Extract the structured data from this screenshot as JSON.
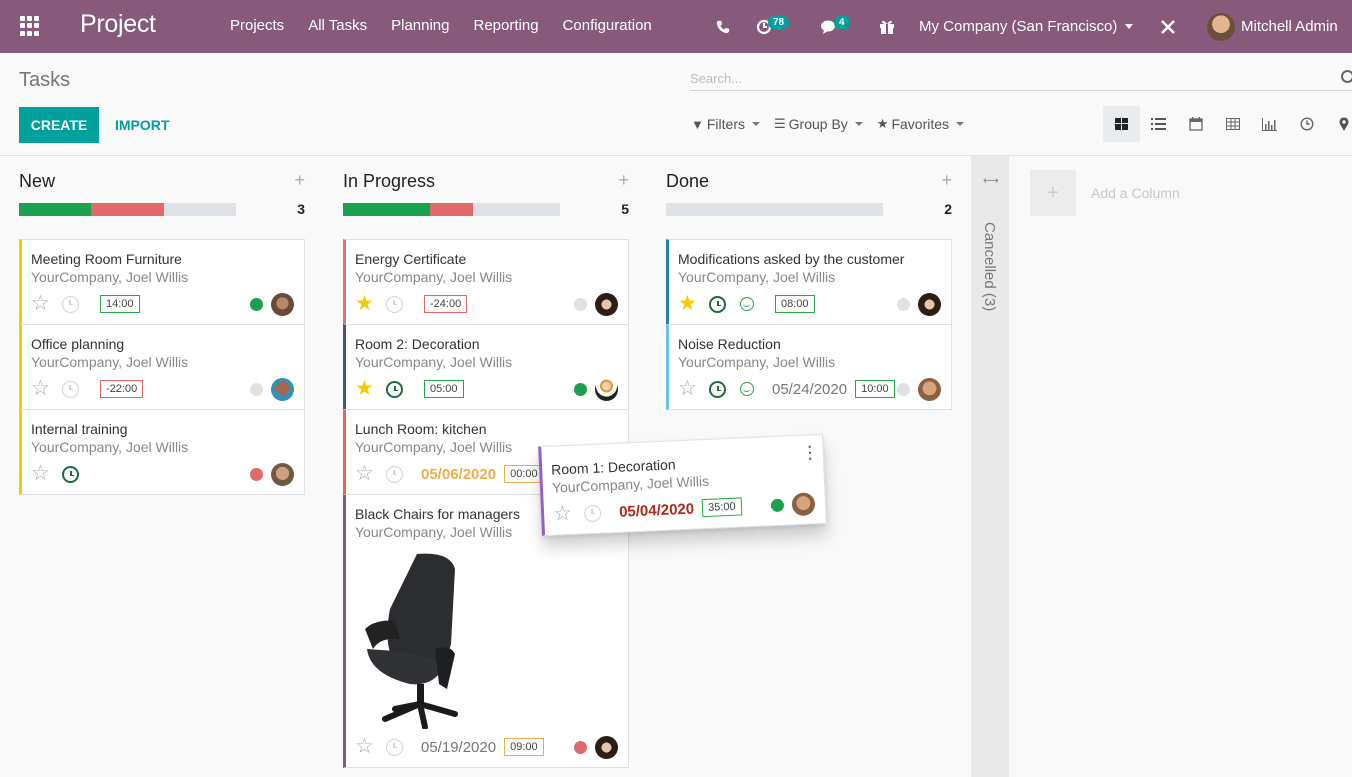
{
  "navbar": {
    "app_name": "Project",
    "menu": [
      "Projects",
      "All Tasks",
      "Planning",
      "Reporting",
      "Configuration"
    ],
    "activity_count": "78",
    "messages_count": "4",
    "company": "My Company (San Francisco)",
    "user": "Mitchell Admin",
    "brand_color": "#875a7b"
  },
  "control_panel": {
    "breadcrumb": "Tasks",
    "create_label": "CREATE",
    "import_label": "IMPORT",
    "search_placeholder": "Search...",
    "filters_label": "Filters",
    "group_by_label": "Group By",
    "favorites_label": "Favorites",
    "views": [
      "kanban",
      "list",
      "calendar",
      "pivot",
      "graph",
      "activity",
      "map"
    ],
    "active_view": "kanban"
  },
  "columns": [
    {
      "title": "New",
      "count": "3",
      "progress": {
        "green": 0.333,
        "red": 0.333,
        "grey": 0.334
      },
      "cards": [
        {
          "title": "Meeting Room Furniture",
          "subtitle": "YourCompany, Joel Willis",
          "starred": false,
          "activity": "grey",
          "date": "",
          "hours": "14:00",
          "hours_color": "green",
          "state": "green",
          "avatar": "av-m1",
          "border": "#f3cc00"
        },
        {
          "title": "Office planning",
          "subtitle": "YourCompany, Joel Willis",
          "starred": false,
          "activity": "grey",
          "date": "",
          "hours": "-22:00",
          "hours_color": "red",
          "state": "grey",
          "avatar": "av-m2",
          "border": "#f3cc00"
        },
        {
          "title": "Internal training",
          "subtitle": "YourCompany, Joel Willis",
          "starred": false,
          "activity": "green",
          "date": "",
          "hours": "",
          "hours_color": "",
          "state": "red",
          "avatar": "av-m3",
          "border": "#f3cc00"
        }
      ]
    },
    {
      "title": "In Progress",
      "count": "5",
      "progress": {
        "green": 0.4,
        "red": 0.2,
        "grey": 0.4
      },
      "cards": [
        {
          "title": "Energy Certificate",
          "subtitle": "YourCompany, Joel Willis",
          "starred": true,
          "activity": "grey",
          "date": "",
          "hours": "-24:00",
          "hours_color": "red",
          "state": "grey",
          "avatar": "av-f1",
          "border": "#f06e6e"
        },
        {
          "title": "Room 2: Decoration",
          "subtitle": "YourCompany, Joel Willis",
          "starred": true,
          "activity": "green",
          "date": "",
          "hours": "05:00",
          "hours_color": "green",
          "state": "green",
          "avatar": "av-f2",
          "border": "#475577"
        },
        {
          "title": "Lunch Room: kitchen",
          "subtitle": "YourCompany, Joel Willis",
          "starred": false,
          "activity": "grey",
          "date": "05/06/2020",
          "date_color": "orange",
          "hours": "00:00",
          "hours_color": "orange",
          "state": "",
          "avatar": "",
          "border": "#f0604f"
        },
        {
          "title": "Black Chairs for managers",
          "subtitle": "YourCompany, Joel Willis",
          "starred": false,
          "activity": "grey",
          "date": "05/19/2020",
          "date_color": "",
          "hours": "09:00",
          "hours_color": "orange",
          "state": "red",
          "avatar": "av-f1",
          "border": "#875a7b",
          "image": "black-office-chair"
        }
      ]
    },
    {
      "title": "Done",
      "count": "2",
      "progress": {
        "green": 0,
        "red": 0,
        "grey": 1
      },
      "cards": [
        {
          "title": "Modifications asked by the customer",
          "subtitle": "YourCompany, Joel Willis",
          "starred": true,
          "activity": "green",
          "smiley": true,
          "date": "",
          "hours": "08:00",
          "hours_color": "green",
          "state": "grey",
          "avatar": "av-f1",
          "border": "#2c8397"
        },
        {
          "title": "Noise Reduction",
          "subtitle": "YourCompany, Joel Willis",
          "starred": false,
          "activity": "green",
          "smiley": true,
          "date": "05/24/2020",
          "date_color": "",
          "hours": "10:00",
          "hours_color": "green",
          "state": "grey",
          "avatar": "av-m4",
          "border": "#6cc1ed"
        }
      ]
    }
  ],
  "folded_column": {
    "label": "Cancelled (3)"
  },
  "add_column_label": "Add a Column",
  "dragged_card": {
    "title": "Room 1: Decoration",
    "subtitle": "YourCompany, Joel Willis",
    "starred": false,
    "activity": "grey",
    "date": "05/04/2020",
    "date_color": "red",
    "hours": "35:00",
    "hours_color": "green",
    "state": "green",
    "avatar": "av-m4"
  }
}
